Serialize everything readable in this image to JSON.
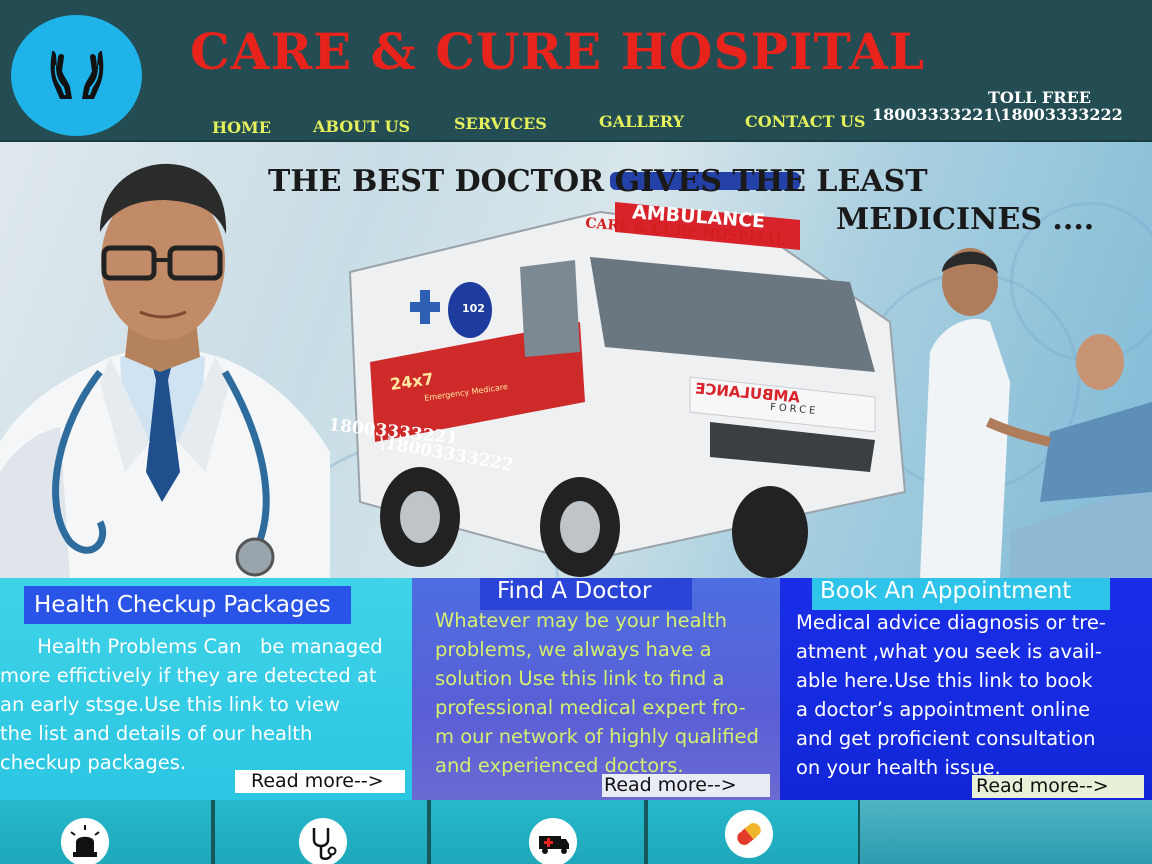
{
  "header": {
    "title": "CARE & CURE HOSPITAL",
    "nav": [
      "HOME",
      "ABOUT US",
      "SERVICES",
      "GALLERY",
      "CONTACT US"
    ],
    "toll_free_label": "TOLL FREE",
    "toll_free_numbers": "18003333221\\18003333222",
    "logo_icon": "hands-icon"
  },
  "hero": {
    "tagline_line1": "THE BEST DOCTOR GIVES THE LEAST",
    "tagline_line2": "MEDICINES ....",
    "ambulance_brand": "CARE & CURE HOSPITAL",
    "ambulance_sign": "AMBULANCE",
    "ambulance_number_1": "18003333221",
    "ambulance_number_2": "\\18003333222",
    "ambulance_side_text": "24x7",
    "ambulance_side_sub": "Emergency Medicare",
    "ambulance_badge": "102",
    "ambulance_hood_text": "AMBULANCE",
    "ambulance_force": "FORCE"
  },
  "cards": [
    {
      "heading": "Health Checkup Packages",
      "body": "      Health Problems Can   be managed\nmore effictively if they are detected at\nan early stsge.Use this link to view\nthe list and details of our health\ncheckup packages.",
      "read_more": "Read more-->"
    },
    {
      "heading": "Find A Doctor",
      "body": "Whatever may be your health\nproblems, we always have a\nsolution Use this link to find a\nprofessional medical expert fro-\nm our network of highly qualified\nand experienced doctors.",
      "read_more": "Read more-->"
    },
    {
      "heading": "Book An Appointment",
      "body": "Medical advice diagnosis or tre-\natment ,what you seek is avail-\nable here.Use this link to book\na doctor’s appointment online\nand get proficient consultation\non your health issue.",
      "read_more": "Read more-->"
    }
  ],
  "icon_strip": [
    "siren-icon",
    "stethoscope-icon",
    "ambulance-icon",
    "pill-icon"
  ],
  "colors": {
    "header_bg": "#234d53",
    "title_red": "#e8231c",
    "nav_yellow": "#e5f05c",
    "logo_blue": "#1fb3ea"
  }
}
